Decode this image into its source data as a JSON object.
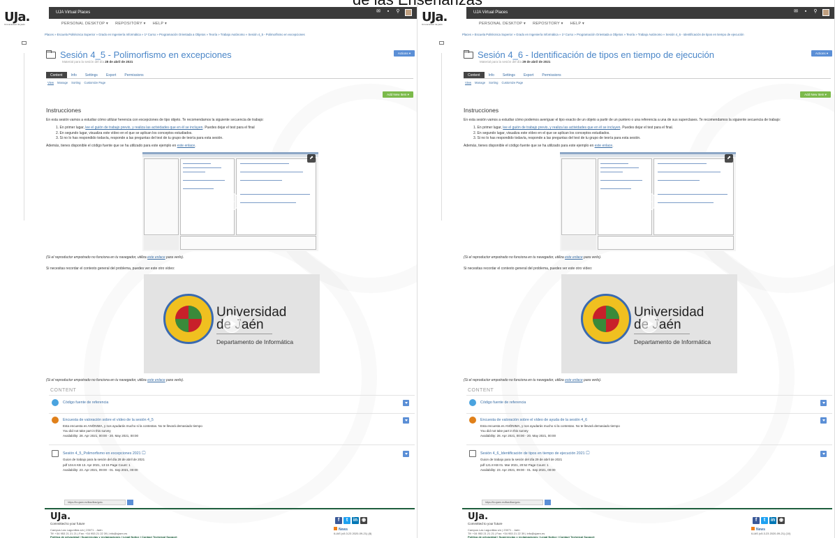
{
  "header_partial": "de las Enseñanzas",
  "colors": {
    "topbar": "#3b3b3b",
    "link": "#3a6ea5",
    "title": "#4a86c8",
    "actions": "#5b8fd6",
    "add_new": "#7cba4b",
    "footer_line": "#1d5e3c"
  },
  "panels": [
    {
      "logo": "UJa.",
      "logo_sub": "Universidad de Jaén",
      "topbar_title": "UJA Virtual Places",
      "nav": [
        "PERSONAL DESKTOP ▾",
        "REPOSITORY ▾",
        "HELP ▾"
      ],
      "breadcrumb": "Places  »  Escuela Politécnica Superior  »  Grado en Ingeniería Informática  »  1º Curso  »  Programación Orientada a Objetos  »  Teoría  »  Trabajo Autónomo  »  Sesión 4_5 - Polimorfismo en excepciones",
      "title": "Sesión 4_5 - Polimorfismo en excepciones",
      "subtitle_prefix": "Material para la sesión del día ",
      "subtitle_date": "28 de abril de 2021",
      "actions_label": "Actions ▾",
      "tabs": [
        "Content",
        "Info",
        "Settings",
        "Export",
        "Permissions"
      ],
      "subtabs": [
        "View",
        "Manage",
        "Sorting",
        "Customize Page"
      ],
      "add_new_label": "Add New Item ▾",
      "instr_heading": "Instrucciones",
      "intro": "En esta sesión vamos a estudiar cómo utilizar herencia con excepciones de tipo objeto. Te recomendamos la siguiente secuencia de trabajo:",
      "steps": [
        {
          "pre": "1. En primer lugar, ",
          "link": "lee el guión de trabajo previo, y realiza las actividades que en él se incluyen",
          "post": ". Puedes dejar el test para el final"
        },
        {
          "pre": "2. En segundo lugar, visualiza este vídeo en el que se aplican los conceptos estudiados.",
          "link": "",
          "post": ""
        },
        {
          "pre": "3. Si no lo has respondido todavía, responde a las preguntas del test de tu grupo de teoría para esta sesión.",
          "link": "",
          "post": ""
        }
      ],
      "source_pre": "Además, tienes disponible el código fuente que se ha utilizado para este ejemplo en ",
      "source_link": "este enlace",
      "source_post": ".",
      "note_pre": "(Si el reproductor empotrado no funciona en tu navegador, utiliza ",
      "note_link": "este enlace",
      "note_post": " para verlo).",
      "context_text": "Si necesitas recordar el contexto general del problema, puedes ver este otro vídeo:",
      "video2_title": "Universidad",
      "video2_title2": "de Jaén",
      "video2_dept": "Departamento de Informática",
      "content_heading": "CONTENT",
      "items": [
        {
          "title": "Código fuente de referencia",
          "lines": []
        },
        {
          "title": "Encuesta de valoración sobre el vídeo de la sesión 4_5",
          "lines": [
            "Esta encuesta es ANÓNIMA, y nos ayudarás mucho si la contestas. No te llevará demasiado tiempo",
            "You did not take part in this survey",
            "Availability: 28. Apr 2021, 00:00 - 20. May 2021, 00:00"
          ]
        },
        {
          "title": "Sesión 4_5_Polimorfismo en excepciones 2021   🖵",
          "lines": [
            "Guion de trabajo para la sesión del día 28 de abril de 2021",
            "pdf   104.6 KB   13. Apr 2021, 13:15   Page Count: 1",
            "Availability: 23. Apr 2021, 09:00 - 01. Sep 2021, 00:00"
          ]
        }
      ],
      "url_text": "https://ilv.ujaen.es/ilias/ilias/goto.",
      "footer_logo": "UJa.",
      "footer_commit": "Committed to your future",
      "footer_addr1": "Campus Las Lagunillas s/n | 23071 - Jaén",
      "footer_addr2": "Tlf: +34 953 21 21 21 | Fax: +34 953 21 22 39 | info@ujaen.es",
      "footer_addr3": "Política de privacidad | Sugerencias y reclamaciones | Legal Notice | Contact Technical Support",
      "footer_news": "News",
      "footer_version": "ILIAS (v5.3.23 2020-09-21) (8)"
    },
    {
      "logo": "UJa.",
      "logo_sub": "Universidad de Jaén",
      "topbar_title": "UJA Virtual Places",
      "nav": [
        "PERSONAL DESKTOP ▾",
        "REPOSITORY ▾",
        "HELP ▾"
      ],
      "breadcrumb": "Places  »  Escuela Politécnica Superior  »  Grado en Ingeniería Informática  »  1º Curso  »  Programación Orientada a Objetos  »  Teoría  »  Trabajo Autónomo  »  Sesión 4_6 - Identificación de tipos en tiempo de ejecución",
      "title": "Sesión 4_6 - Identificación de tipos en tiempo de ejecución",
      "subtitle_prefix": "Material para la sesión del día ",
      "subtitle_date": "29 de abril de 2021",
      "actions_label": "Actions ▾",
      "tabs": [
        "Content",
        "Info",
        "Settings",
        "Export",
        "Permissions"
      ],
      "subtabs": [
        "View",
        "Manage",
        "Sorting",
        "Customize Page"
      ],
      "add_new_label": "Add New Item ▾",
      "instr_heading": "Instrucciones",
      "intro": "En esta sesión vamos a estudiar cómo podemos averiguar el tipo exacto de un objeto a partir de un puntero o una referencia a una de sus superclases. Te recomendamos la siguiente secuencia de trabajo:",
      "steps": [
        {
          "pre": "1. En primer lugar, ",
          "link": "lee el guión de trabajo previo, y realiza las actividades que en él se incluyen",
          "post": ". Puedes dejar el test para el final."
        },
        {
          "pre": "2. En segundo lugar, visualiza este vídeo en el que se aplican los conceptos estudiados.",
          "link": "",
          "post": ""
        },
        {
          "pre": "3. Si no lo has respondido todavía, responde a las preguntas del test de tu grupo de teoría para esta sesión.",
          "link": "",
          "post": ""
        }
      ],
      "source_pre": "Además, tienes disponible el código fuente que se ha utilizado para este ejemplo en ",
      "source_link": "este enlace",
      "source_post": ".",
      "note_pre": "(Si el reproductor empotrado no funciona en tu navegador, utiliza ",
      "note_link": "este enlace",
      "note_post": " para verlo).",
      "context_text": "Si necesitas recordar el contexto general del problema, puedes ver este otro vídeo:",
      "video2_title": "Universidad",
      "video2_title2": "de Jaén",
      "video2_dept": "Departamento de Informática",
      "content_heading": "CONTENT",
      "items": [
        {
          "title": "Código fuente de referencia",
          "lines": []
        },
        {
          "title": "Encuesta de valoración sobre el vídeo de ayuda de la sesión 4_6",
          "lines": [
            "Esta encuesta es ANÓNIMA, y nos ayudarás mucho si la contestas. No te llevará demasiado tiempo",
            "You did not take part in this survey",
            "Availability: 28. Apr 2021, 00:00 - 20. May 2021, 00:00"
          ]
        },
        {
          "title": "Sesión 4_6_Identificación de tipos en tiempo de ejecución 2021   🖵",
          "lines": [
            "Guion de trabajo para la sesión del día 29 de abril de 2021",
            "pdf   121.8 KB   01. Mar 2021, 20:52   Page Count: 1",
            "Availability: 23. Apr 2021, 09:00 - 01. Sep 2021, 00:00"
          ]
        }
      ],
      "url_text": "https://ilv.ujaen.es/ilias/ilias/goto.",
      "footer_logo": "UJa.",
      "footer_commit": "Committed to your future",
      "footer_addr1": "Campus Las Lagunillas s/n | 23071 - Jaén",
      "footer_addr2": "Tlf: +34 953 21 21 21 | Fax: +34 953 21 22 39 | info@ujaen.es",
      "footer_addr3": "Política de privacidad | Sugerencias y reclamaciones | Legal Notice | Contact Technical Support",
      "footer_news": "News",
      "footer_version": "ILIAS (v5.3.23 2020-09-21) (10)"
    }
  ]
}
